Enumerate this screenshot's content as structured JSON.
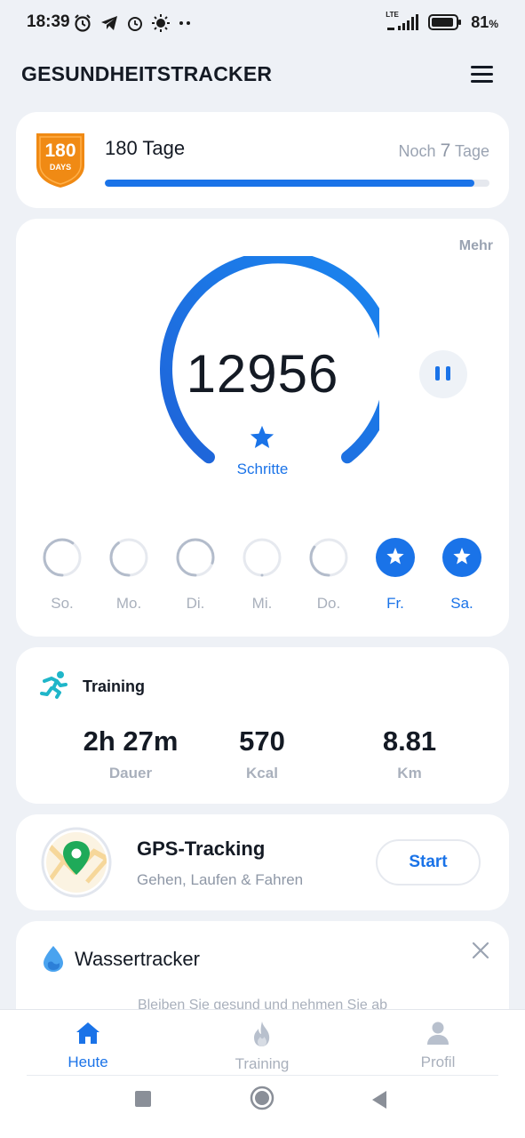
{
  "status_bar": {
    "time": "18:39",
    "network": "LTE",
    "battery_percent": "81",
    "battery_symbol": "%"
  },
  "header": {
    "title": "GESUNDHEITSTRACKER"
  },
  "streak": {
    "badge_number": "180",
    "badge_unit": "DAYS",
    "title": "180 Tage",
    "remaining_prefix": "Noch",
    "remaining_days": "7",
    "remaining_suffix": "Tage",
    "progress": 0.96
  },
  "steps": {
    "more_label": "Mehr",
    "value": "12956",
    "label": "Schritte",
    "days": [
      {
        "label": "So.",
        "progress": 0.6,
        "complete": false
      },
      {
        "label": "Mo.",
        "progress": 0.4,
        "complete": false
      },
      {
        "label": "Di.",
        "progress": 0.8,
        "complete": false
      },
      {
        "label": "Mi.",
        "progress": 0.0,
        "complete": false
      },
      {
        "label": "Do.",
        "progress": 0.35,
        "complete": false
      },
      {
        "label": "Fr.",
        "progress": 1.0,
        "complete": true
      },
      {
        "label": "Sa.",
        "progress": 1.0,
        "complete": true
      }
    ]
  },
  "training": {
    "title": "Training",
    "stats": [
      {
        "value": "2h 27m",
        "label": "Dauer"
      },
      {
        "value": "570",
        "label": "Kcal"
      },
      {
        "value": "8.81",
        "label": "Km"
      }
    ]
  },
  "gps": {
    "title": "GPS-Tracking",
    "subtitle": "Gehen, Laufen & Fahren",
    "start_label": "Start"
  },
  "water": {
    "title": "Wassertracker",
    "subtitle": "Bleiben Sie gesund und nehmen Sie ab"
  },
  "bottom_nav": {
    "items": [
      {
        "label": "Heute",
        "icon": "home-icon",
        "active": true
      },
      {
        "label": "Training",
        "icon": "flame-icon",
        "active": false
      },
      {
        "label": "Profil",
        "icon": "person-icon",
        "active": false
      }
    ]
  },
  "colors": {
    "accent": "#1a73e8",
    "badge_orange": "#f08a14",
    "muted": "#a9b0bc",
    "background": "#eef1f6"
  }
}
